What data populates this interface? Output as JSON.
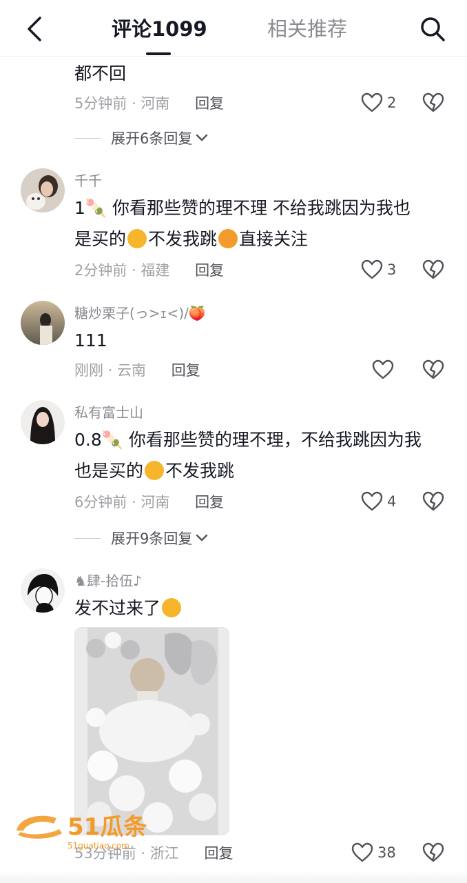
{
  "header": {
    "tab_comments": "评论1099",
    "tab_related": "相关推荐"
  },
  "comments": [
    {
      "content_tail": "都不回",
      "time": "5分钟前",
      "location": "河南",
      "reply_label": "回复",
      "likes": "2",
      "expand_label": "展开6条回复"
    },
    {
      "username": "千千",
      "content_line1": "1🍡 你看那些赞的理不理 不给我跳因为我也",
      "content_line2_a": "是买的",
      "content_line2_b": "不发我跳",
      "content_line2_c": "直接关注",
      "time": "2分钟前",
      "location": "福建",
      "reply_label": "回复",
      "likes": "3"
    },
    {
      "username": "糖炒栗子(っ>ｪ<)/🍑",
      "content": "111",
      "time": "刚刚",
      "location": "云南",
      "reply_label": "回复",
      "likes": ""
    },
    {
      "username": "私有富士山",
      "content_line1": "0.8🍡 你看那些赞的理不理，不给我跳因为我",
      "content_line2_a": "也是买的",
      "content_line2_b": "不发我跳",
      "time": "6分钟前",
      "location": "河南",
      "reply_label": "回复",
      "likes": "4",
      "expand_label": "展开9条回复"
    },
    {
      "username": "♞肆-拾伍♪",
      "content": "发不过来了",
      "time": "53分钟前",
      "location": "浙江",
      "reply_label": "回复",
      "likes": "38"
    }
  ],
  "watermark": {
    "brand": "51瓜条",
    "url": "51guatiao.com"
  },
  "colors": {
    "text": "#161823",
    "secondary": "#8a8b91",
    "watermark": "#f29b2a"
  }
}
